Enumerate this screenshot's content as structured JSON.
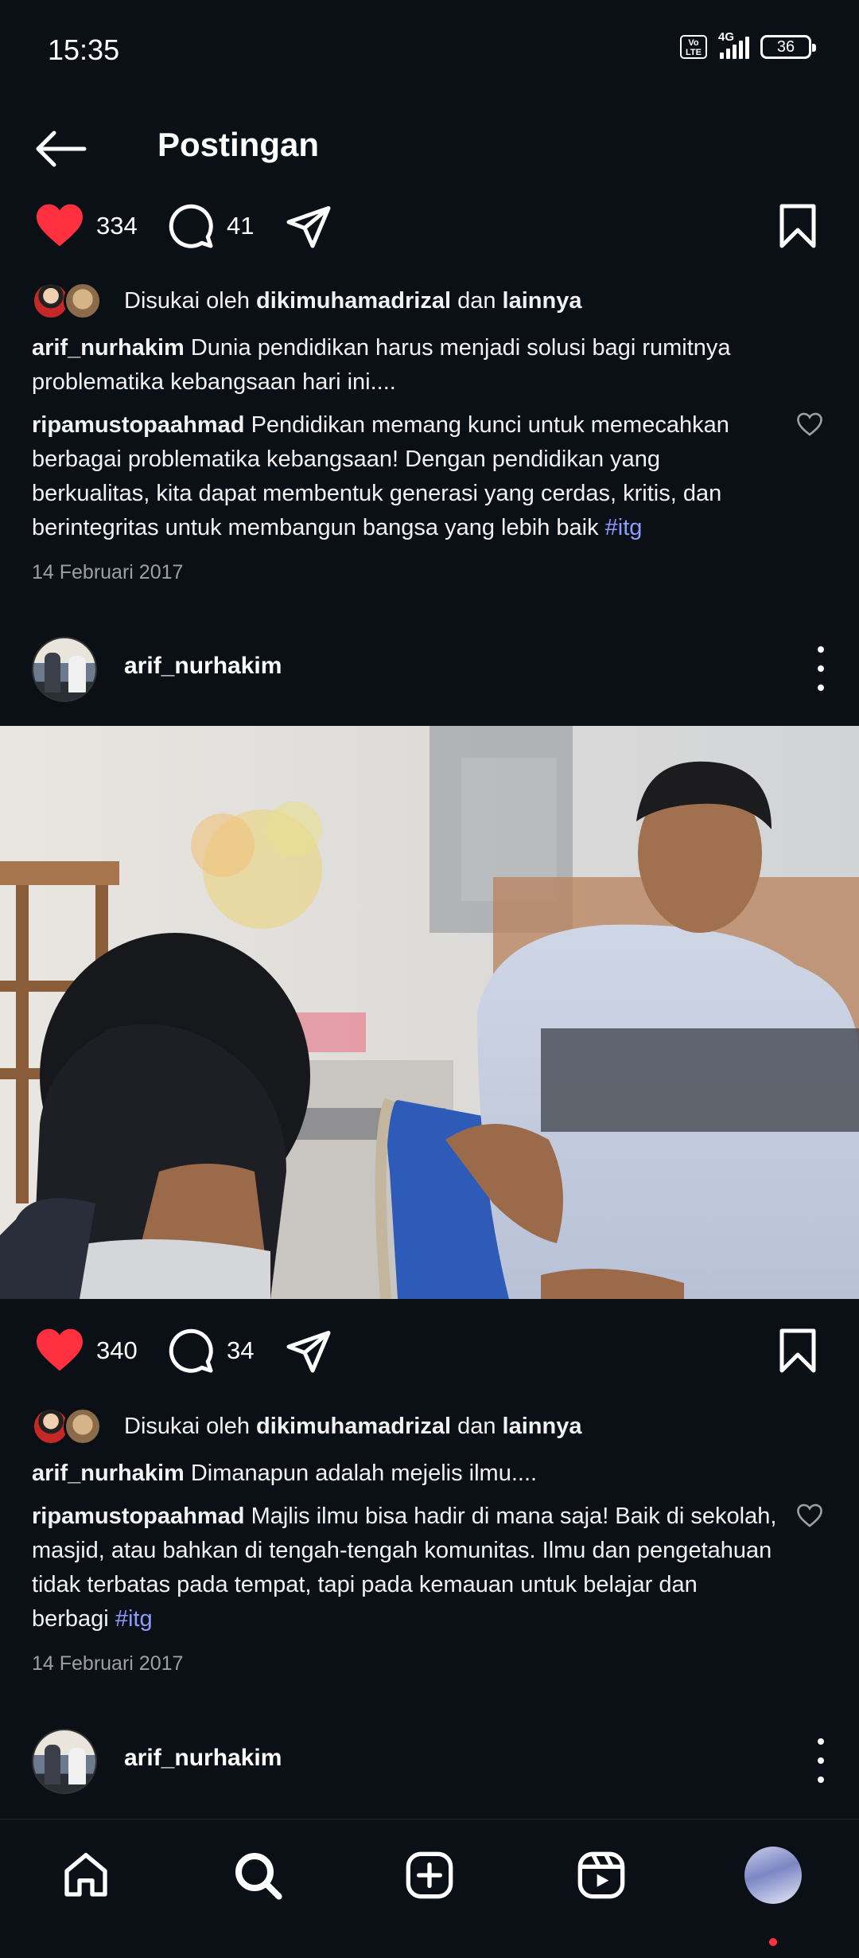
{
  "status_bar": {
    "time": "15:35",
    "volte_label": "Vo LTE",
    "network": "4G",
    "battery": "36"
  },
  "header": {
    "title": "Postingan",
    "back_icon": "arrow-left-icon"
  },
  "posts": [
    {
      "likes": "334",
      "comments": "41",
      "liked_by_prefix": "Disukai oleh",
      "liked_by_user": "dikimuhamadrizal",
      "liked_by_conj": "dan",
      "liked_by_others": "lainnya",
      "caption_user": "arif_nurhakim",
      "caption_text": "Dunia pendidikan harus menjadi solusi bagi rumitnya problematika kebangsaan hari ini....",
      "comment_user": "ripamustopaahmad",
      "comment_text": "Pendidikan memang kunci untuk memecahkan berbagai problematika kebangsaan! Dengan pendidikan yang berkualitas, kita dapat membentuk generasi yang cerdas, kritis, dan berintegritas untuk membangun bangsa yang lebih baik",
      "comment_hashtag": "#itg",
      "date": "14 Februari 2017"
    },
    {
      "author": "arif_nurhakim",
      "likes": "340",
      "comments": "34",
      "liked_by_prefix": "Disukai oleh",
      "liked_by_user": "dikimuhamadrizal",
      "liked_by_conj": "dan",
      "liked_by_others": "lainnya",
      "caption_user": "arif_nurhakim",
      "caption_text": "Dimanapun adalah mejelis ilmu....",
      "comment_user": "ripamustopaahmad",
      "comment_text": "Majlis ilmu bisa hadir di mana saja! Baik di sekolah, masjid, atau bahkan di tengah-tengah komunitas. Ilmu dan pengetahuan tidak terbatas pada tempat, tapi pada kemauan untuk belajar dan berbagi",
      "comment_hashtag": "#itg",
      "date": "14 Februari 2017"
    },
    {
      "author": "arif_nurhakim"
    }
  ],
  "colors": {
    "background": "#0b0f16",
    "like_red": "#ff3040",
    "hashtag": "#8e9cff"
  },
  "bottom_nav": {
    "items": [
      "home-icon",
      "search-icon",
      "create-post-icon",
      "reels-icon",
      "profile-avatar"
    ]
  }
}
